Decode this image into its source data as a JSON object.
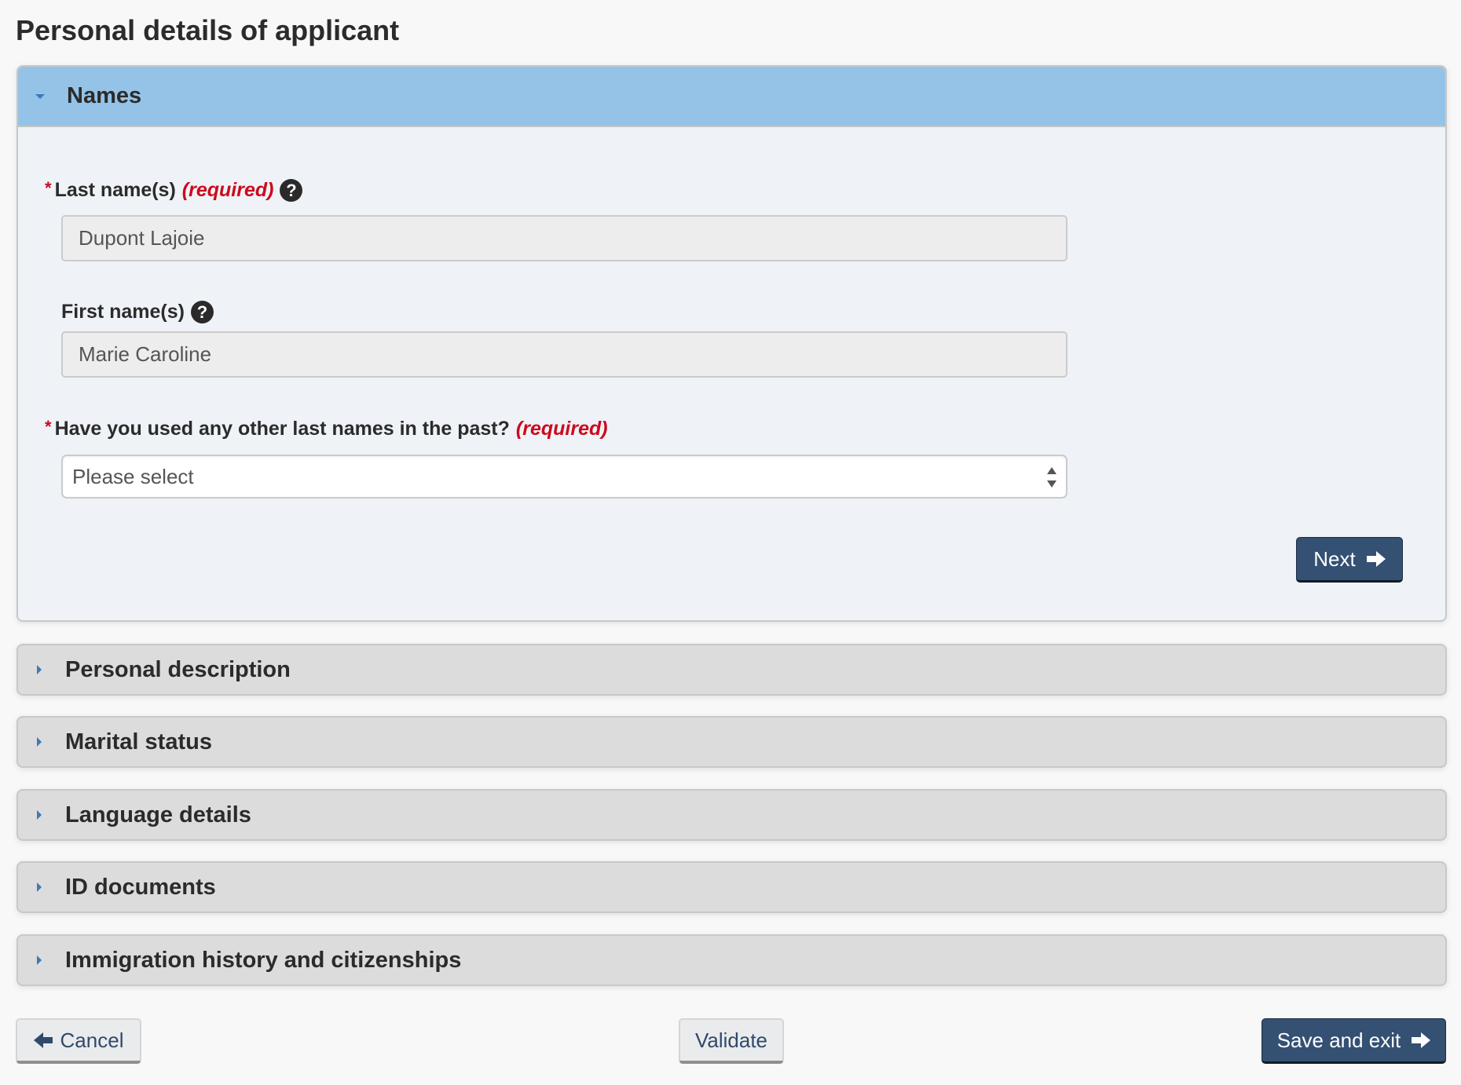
{
  "page": {
    "title": "Personal details of applicant"
  },
  "names_section": {
    "title": "Names",
    "expanded": true,
    "last_name": {
      "asterisk": "*",
      "label": "Last name(s)",
      "required_text": "(required)",
      "help_glyph": "?",
      "value": "Dupont Lajoie"
    },
    "first_name": {
      "label": "First name(s)",
      "help_glyph": "?",
      "value": "Marie Caroline"
    },
    "other_names": {
      "asterisk": "*",
      "label": "Have you used any other last names in the past?",
      "required_text": "(required)",
      "selected": "Please select"
    },
    "next_label": "Next"
  },
  "collapsed_sections": [
    {
      "title": "Personal description"
    },
    {
      "title": "Marital status"
    },
    {
      "title": "Language details"
    },
    {
      "title": "ID documents"
    },
    {
      "title": "Immigration history and citizenships"
    }
  ],
  "footer": {
    "cancel_label": "Cancel",
    "validate_label": "Validate",
    "save_exit_label": "Save and exit"
  },
  "icons": {
    "expanded_caret": "caret-down-icon",
    "collapsed_caret": "caret-right-icon",
    "help": "question-circle-icon",
    "forward": "arrow-right-icon",
    "back": "arrow-left-icon"
  },
  "colors": {
    "header_active": "#95c3e7",
    "panel_collapsed": "#dcdcdc",
    "primary_button": "#345072",
    "required_red": "#cc0a1e"
  }
}
